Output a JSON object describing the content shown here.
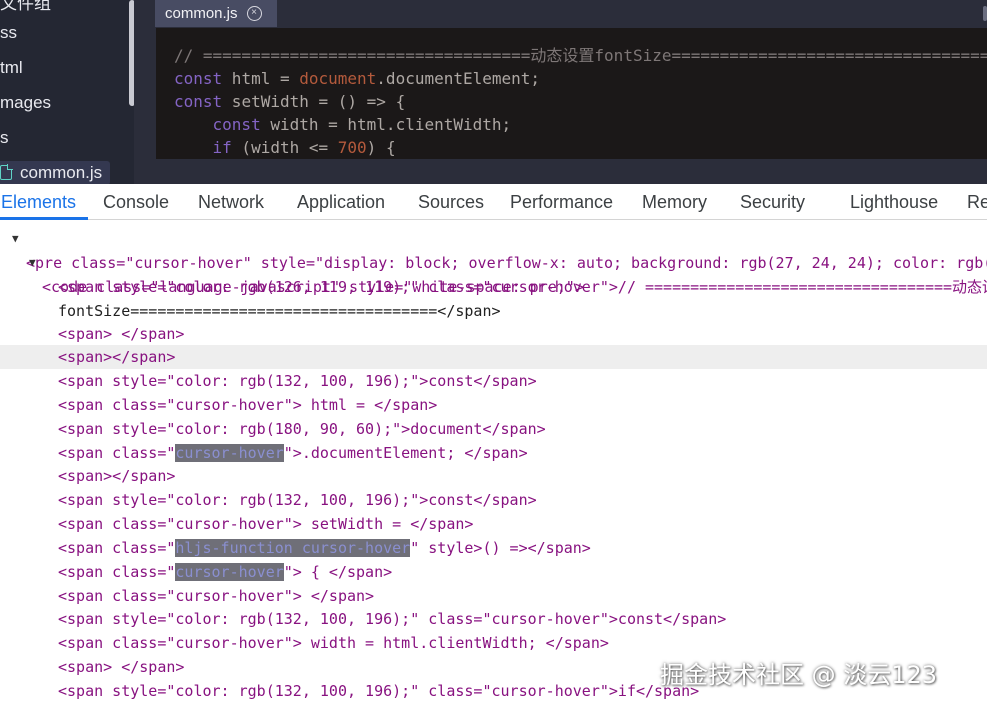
{
  "sidebar": {
    "items": [
      {
        "label": "文件组",
        "icon": null
      },
      {
        "label": "ss",
        "icon": null
      },
      {
        "label": "tml",
        "icon": null
      },
      {
        "label": "mages",
        "icon": null
      },
      {
        "label": "s",
        "icon": null
      },
      {
        "label": "common.js",
        "icon": "file-icon"
      }
    ]
  },
  "editor_tab": {
    "label": "common.js",
    "close_icon": "⊗"
  },
  "code_lines": [
    {
      "comment": "// ==================================动态设置fontSize=================================="
    },
    {
      "kw": "const",
      "plain1": " html = ",
      "obj": "document",
      "plain2": ".documentElement;"
    },
    {
      "kw": "const",
      "plain1": " setWidth = () => {"
    },
    {
      "kw": "const",
      "plain1": " width = html.clientWidth;"
    },
    {
      "kw": "if",
      "plain1": " (width <= ",
      "num": "700",
      "plain2": ") {"
    }
  ],
  "devtools_tabs": [
    "Elements",
    "Console",
    "Network",
    "Application",
    "Sources",
    "Performance",
    "Memory",
    "Security",
    "Lighthouse",
    "Re"
  ],
  "active_tab": "Elements",
  "colors": {
    "accent": "#1a73e8",
    "tag": "#881280",
    "attr_name": "#994500",
    "attr_value": "#1a1aa6"
  },
  "tree": {
    "pre_line": "<pre class=\"cursor-hover\" style=\"display: block; overflow-x: auto; background: rgb(27, 24, 24); color: rgb(",
    "code_line": "<code class=\"language-javascript\" style=\"white-space: pre;\">",
    "l1": "<span style=\"color: rgb(126, 119, 119);\" class=\"cursor-hover\">// ==================================动态设",
    "l2": "fontSize==================================</span>",
    "l3": "<span> </span>",
    "l4": "<span></span>",
    "l5": "<span style=\"color: rgb(132, 100, 196);\">const</span>",
    "l6": "<span class=\"cursor-hover\"> html = </span>",
    "l7": "<span style=\"color: rgb(180, 90, 60);\">document</span>",
    "l8_a": "<span class=\"",
    "l8_hl": "cursor-hover",
    "l8_b": "\">.documentElement; </span>",
    "l9": "<span></span>",
    "l10": "<span style=\"color: rgb(132, 100, 196);\">const</span>",
    "l11": "<span class=\"cursor-hover\"> setWidth = </span>",
    "l12_a": "<span class=\"",
    "l12_hl": "hljs-function cursor-hover",
    "l12_b": "\" style>() =></span>",
    "l13_a": "<span class=\"",
    "l13_hl": "cursor-hover",
    "l13_b": "\"> { </span>",
    "l14": "<span class=\"cursor-hover\"> </span>",
    "l15": "<span style=\"color: rgb(132, 100, 196);\" class=\"cursor-hover\">const</span>",
    "l16": "<span class=\"cursor-hover\"> width = html.clientWidth; </span>",
    "l17": "<span> </span>",
    "l18": "<span style=\"color: rgb(132, 100, 196);\" class=\"cursor-hover\">if</span>"
  },
  "watermark": "掘金技术社区 @ 淡云123"
}
